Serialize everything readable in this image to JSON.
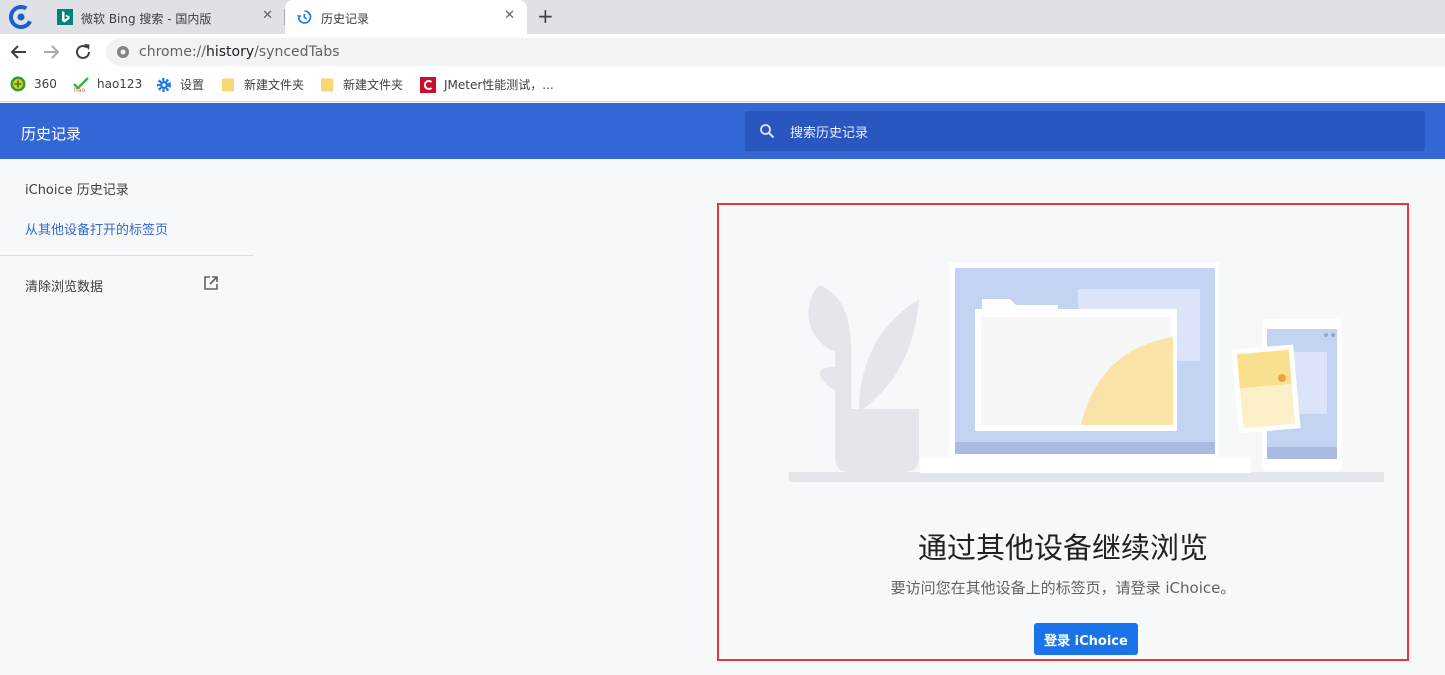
{
  "tabs": [
    {
      "title": "微软 Bing 搜索 - 国内版",
      "favicon": "bing-icon"
    },
    {
      "title": "历史记录",
      "favicon": "history-icon",
      "active": true
    }
  ],
  "toolbar": {
    "url_scheme": "chrome://",
    "url_host": "history",
    "url_path": "/syncedTabs"
  },
  "bookmarks": [
    {
      "label": "360",
      "icon": "360-icon"
    },
    {
      "label": "hao123",
      "icon": "hao123-icon"
    },
    {
      "label": "设置",
      "icon": "gear-icon"
    },
    {
      "label": "新建文件夹",
      "icon": "folder-icon"
    },
    {
      "label": "新建文件夹",
      "icon": "folder-icon"
    },
    {
      "label": "JMeter性能测试，...",
      "icon": "jmeter-icon"
    }
  ],
  "header": {
    "title": "历史记录",
    "search_placeholder": "搜索历史记录"
  },
  "sidebar": {
    "items": [
      {
        "label": "iChoice 历史记录"
      },
      {
        "label": "从其他设备打开的标签页",
        "selected": true
      },
      {
        "label": "清除浏览数据"
      }
    ]
  },
  "promo": {
    "title": "通过其他设备继续浏览",
    "description": "要访问您在其他设备上的标签页，请登录 iChoice。",
    "button": "登录 iChoice"
  },
  "colors": {
    "header": "#3367d6",
    "search": "#2a56c0",
    "button": "#1a73e8",
    "highlight_border": "#e23a3a"
  }
}
